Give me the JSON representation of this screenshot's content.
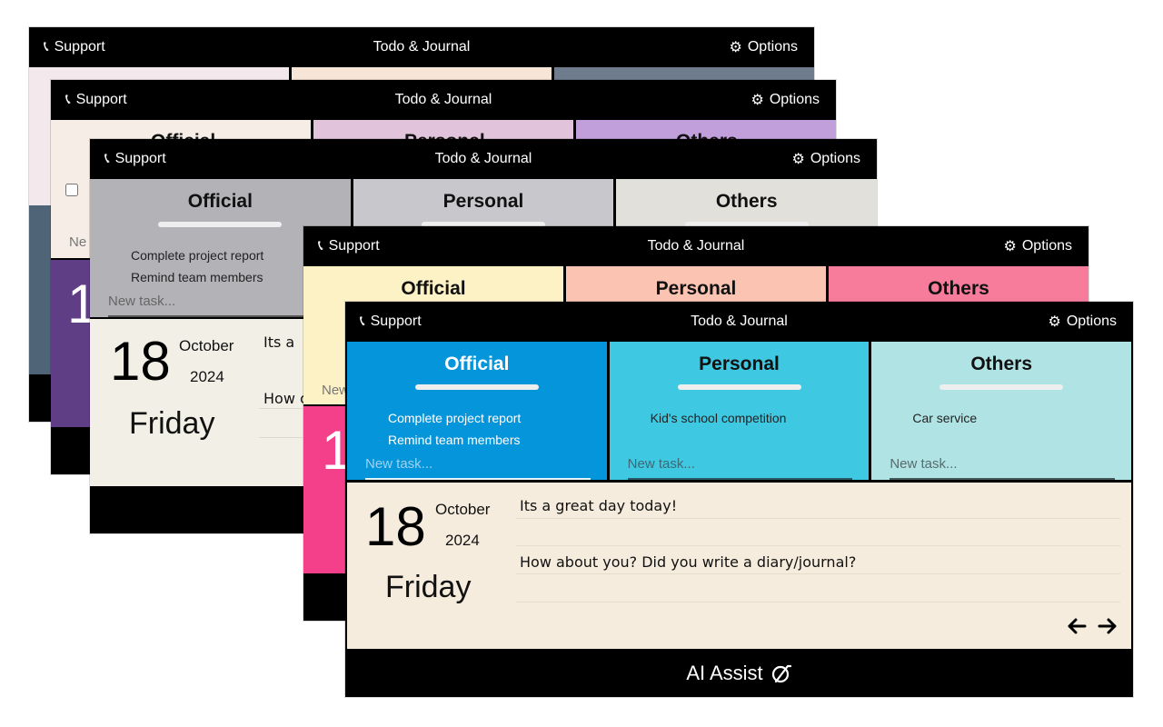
{
  "app": {
    "support_label": "Support",
    "title": "Todo & Journal",
    "options_label": "Options"
  },
  "columns": {
    "official": "Official",
    "personal": "Personal",
    "others": "Others"
  },
  "tasks": {
    "official": [
      "Complete project report",
      "Remind team members"
    ],
    "personal": [
      "Kid's school competition"
    ],
    "others": [
      "Car service"
    ],
    "placeholder": "New task..."
  },
  "date": {
    "day": "18",
    "month": "October",
    "year": "2024",
    "weekday": "Friday"
  },
  "journal": {
    "entry1": "Its a great day today!",
    "entry2": "How about you? Did you write a diary/journal?",
    "entry1_partial": "Its a",
    "entry2_partial": "How c"
  },
  "footer": {
    "ai_label": "AI Assist"
  },
  "themes": {
    "w1": [
      "#f3e9ec",
      "#f7e6d8",
      "#6e7c8d"
    ],
    "w2": [
      "#f6eee6",
      "#e1c3db",
      "#c19fdb"
    ],
    "w3": [
      "#b3b2b7",
      "#c8c8cc",
      "#e2e0db"
    ],
    "w4": [
      "#fdf1c6",
      "#fbc3b1",
      "#f77c9c"
    ],
    "w5": [
      "#0595db",
      "#3ec8e1",
      "#b0e3e4"
    ]
  },
  "icons": {
    "support": "phone-icon",
    "options": "gear-icon",
    "prev": "arrow-left-icon",
    "next": "arrow-right-icon",
    "ai": "ai-assist-icon"
  }
}
